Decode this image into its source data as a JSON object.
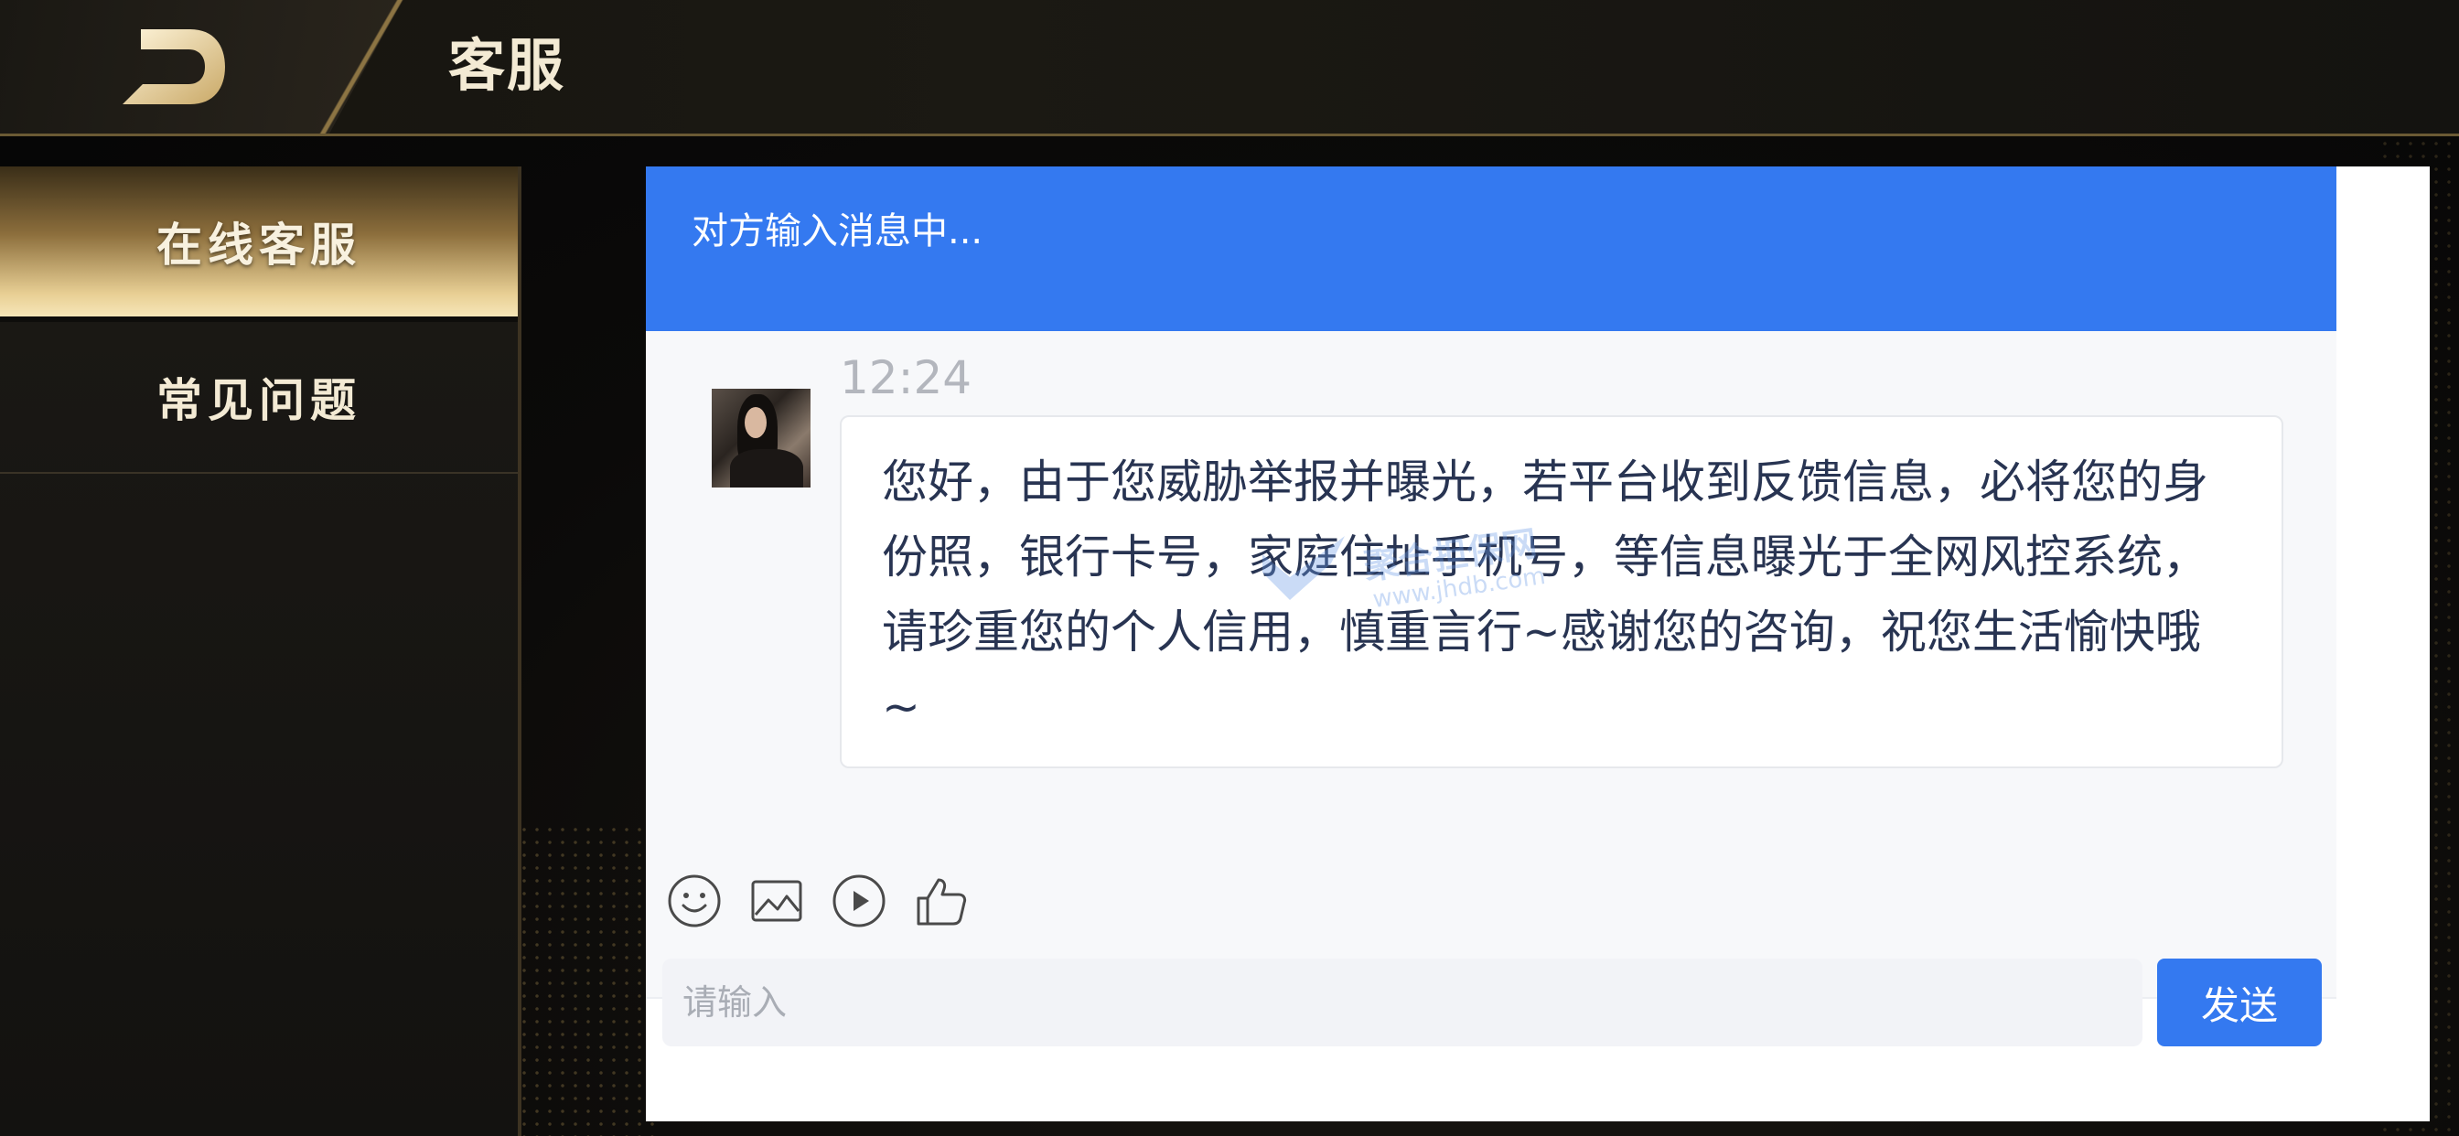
{
  "header": {
    "title": "客服",
    "back_icon": "back-arrow-icon"
  },
  "sidebar": {
    "items": [
      {
        "label": "在线客服",
        "active": true
      },
      {
        "label": "常见问题",
        "active": false
      }
    ]
  },
  "chat": {
    "status": "对方输入消息中...",
    "messages": [
      {
        "time": "12:24",
        "text": "您好，由于您威胁举报并曝光，若平台收到反馈信息，必将您的身份照，银行卡号，家庭住址手机号，等信息曝光于全网风控系统，请珍重您的个人信用，慎重言行~感谢您的咨询，祝您生活愉快哦~"
      }
    ],
    "watermark": {
      "text": "聚合担保网",
      "url": "www.jhdb.com"
    },
    "tools": [
      "emoji-icon",
      "image-icon",
      "video-icon",
      "thumbs-up-icon"
    ],
    "input": {
      "placeholder": "请输入",
      "value": ""
    },
    "send_label": "发送"
  },
  "colors": {
    "accent_blue": "#3479f0",
    "gold": "#e8cf94",
    "dark_bg": "#0b0a09"
  }
}
